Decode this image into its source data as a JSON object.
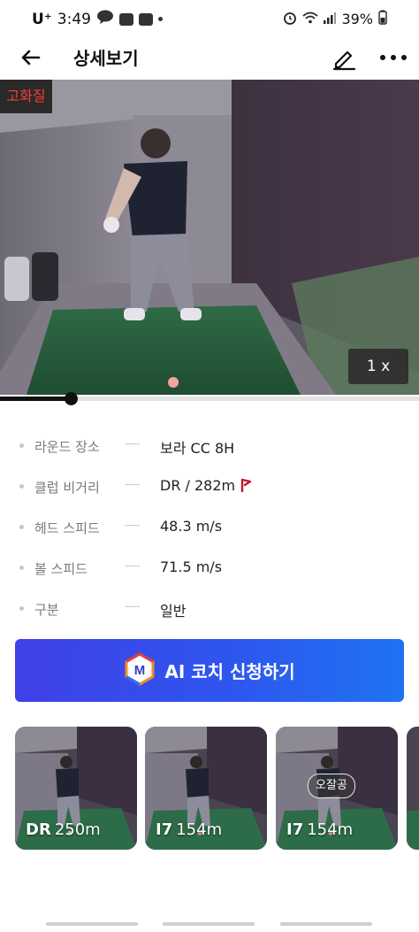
{
  "status_bar": {
    "carrier": "U⁺",
    "time": "3:49",
    "battery": "39%"
  },
  "header": {
    "title": "상세보기"
  },
  "video": {
    "quality_badge": "고화질",
    "playback_speed": "1 x",
    "progress": 0.17
  },
  "details": [
    {
      "label": "라운드 장소",
      "separator": "-----",
      "value": "보라 CC 8H"
    },
    {
      "label": "클럽 비거리",
      "separator": "-----",
      "value": "DR / 282m"
    },
    {
      "label": "헤드 스피드",
      "separator": "-----",
      "value": "48.3 m/s"
    },
    {
      "label": "볼 스피드",
      "separator": "-----",
      "value": "71.5 m/s"
    },
    {
      "label": "구분",
      "separator": "-----",
      "value": "일반"
    }
  ],
  "ai_button": {
    "logo_letter": "M",
    "label": "AI 코치 신청하기"
  },
  "thumbnails": [
    {
      "club": "DR",
      "distance": "250m",
      "tag": ""
    },
    {
      "club": "I7",
      "distance": "154m",
      "tag": ""
    },
    {
      "club": "I7",
      "distance": "154m",
      "tag": "오잘공"
    }
  ],
  "colors": {
    "accent_start": "#4040e6",
    "accent_end": "#1f73f2",
    "quality_text": "#ff3b3b",
    "distance_flag": "#c0182b"
  },
  "icons": {
    "back": "arrow-left-icon",
    "edit": "pencil-icon",
    "more": "more-horizontal-icon",
    "flag": "red-flag-icon"
  }
}
